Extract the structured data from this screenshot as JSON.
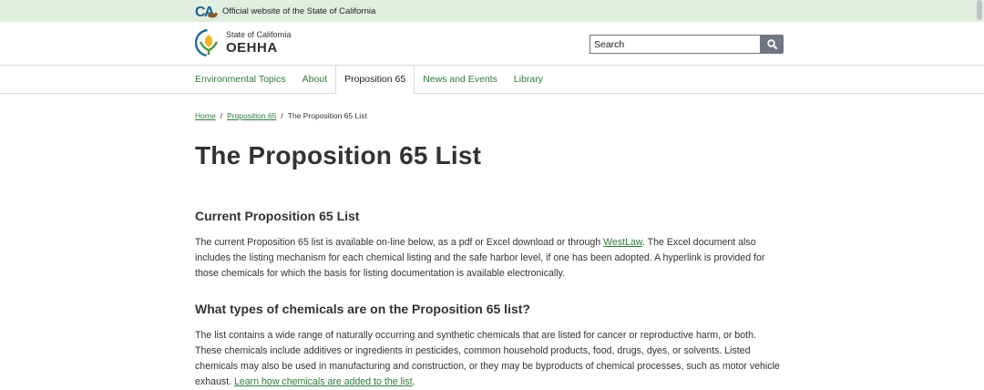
{
  "banner": {
    "text": "Official website of the State of California"
  },
  "brand": {
    "small": "State of California",
    "name": "OEHHA"
  },
  "search": {
    "placeholder": "Search"
  },
  "nav": {
    "items": [
      {
        "label": "Environmental Topics"
      },
      {
        "label": "About"
      },
      {
        "label": "Proposition 65"
      },
      {
        "label": "News and Events"
      },
      {
        "label": "Library"
      }
    ]
  },
  "breadcrumb": {
    "home": "Home",
    "prop65": "Proposition 65",
    "current": "The Proposition 65 List",
    "sep": "/"
  },
  "page": {
    "title": "The Proposition 65 List"
  },
  "section1": {
    "heading": "Current Proposition 65 List",
    "p_before": "The current Proposition 65 list is available on-line below, as a pdf or Excel download or through ",
    "link": "WestLaw",
    "p_after": ". The Excel document also includes the listing mechanism for each chemical listing and the safe harbor level, if one has been adopted. A hyperlink is provided for those chemicals for which the basis for listing documentation is available electronically."
  },
  "section2": {
    "heading": "What types of chemicals are on the Proposition 65 list?",
    "p_before": "The list contains a wide range of naturally occurring and synthetic chemicals that are listed for cancer or reproductive harm, or both. These chemicals include additives or ingredients in pesticides, common household products, food, drugs, dyes, or solvents. Listed chemicals may also be used in manufacturing and construction, or they may be byproducts of chemical processes, such as motor vehicle exhaust. ",
    "link": "Learn how chemicals are added to the list",
    "p_after": "."
  },
  "colors": {
    "banner_bg": "#e0efe0",
    "link_green": "#2f7a39",
    "search_button": "#6f7680"
  }
}
